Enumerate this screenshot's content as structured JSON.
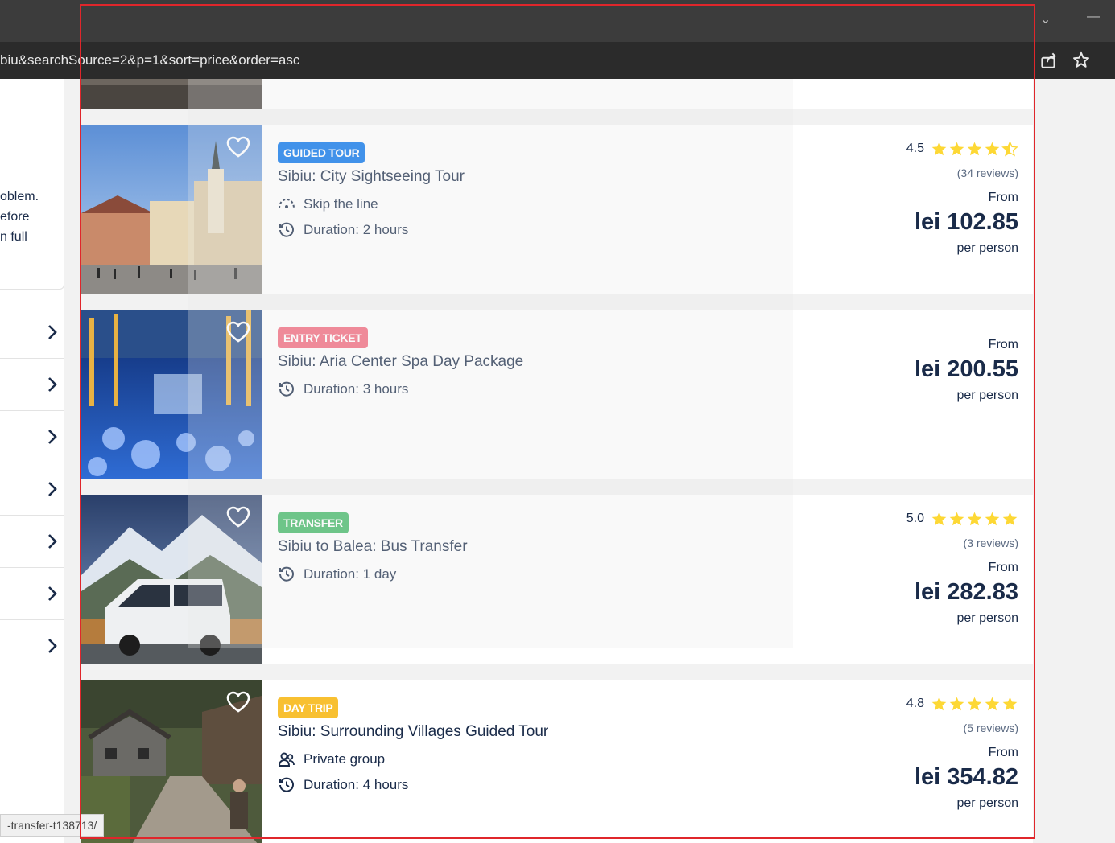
{
  "browser": {
    "url_fragment": "biu&searchSource=2&p=1&sort=price&order=asc"
  },
  "sidebar": {
    "text_lines": [
      "oblem.",
      "efore",
      "n full"
    ]
  },
  "status_bar": {
    "text": "-transfer-t138713/"
  },
  "colors": {
    "brand_blue": "#0071eb",
    "entry_red": "#f2667a",
    "transfer_green": "#3fb765",
    "daytrip_yellow": "#f8c031",
    "star": "#fdd835",
    "text": "#1a2b49"
  },
  "cards": [
    {
      "badge": "GUIDED TOUR",
      "badge_color": "#0071eb",
      "badge_text_color": "#ffffff",
      "title": "Sibiu: City Sightseeing Tour",
      "features": [
        {
          "icon": "skip-line-icon",
          "label": "Skip the line"
        },
        {
          "icon": "clock-icon",
          "label": "Duration: 2 hours"
        }
      ],
      "rating": "4.5",
      "stars": 4.5,
      "reviews": "(34 reviews)",
      "from_label": "From",
      "price": "lei 102.85",
      "per_label": "per person"
    },
    {
      "badge": "ENTRY TICKET",
      "badge_color": "#f2667a",
      "badge_text_color": "#ffffff",
      "title": "Sibiu: Aria Center Spa Day Package",
      "features": [
        {
          "icon": "clock-icon",
          "label": "Duration: 3 hours"
        }
      ],
      "rating": "",
      "stars": 0,
      "reviews": "",
      "from_label": "From",
      "price": "lei 200.55",
      "per_label": "per person"
    },
    {
      "badge": "TRANSFER",
      "badge_color": "#3fb765",
      "badge_text_color": "#ffffff",
      "title": "Sibiu to Balea: Bus Transfer",
      "features": [
        {
          "icon": "clock-icon",
          "label": "Duration: 1 day"
        }
      ],
      "rating": "5.0",
      "stars": 5,
      "reviews": "(3 reviews)",
      "from_label": "From",
      "price": "lei 282.83",
      "per_label": "per person"
    },
    {
      "badge": "DAY TRIP",
      "badge_color": "#f8c031",
      "badge_text_color": "#ffffff",
      "title": "Sibiu: Surrounding Villages Guided Tour",
      "features": [
        {
          "icon": "private-group-icon",
          "label": "Private group"
        },
        {
          "icon": "clock-icon",
          "label": "Duration: 4 hours"
        }
      ],
      "rating": "4.8",
      "stars": 5,
      "reviews": "(5 reviews)",
      "from_label": "From",
      "price": "lei 354.82",
      "per_label": "per person"
    }
  ]
}
